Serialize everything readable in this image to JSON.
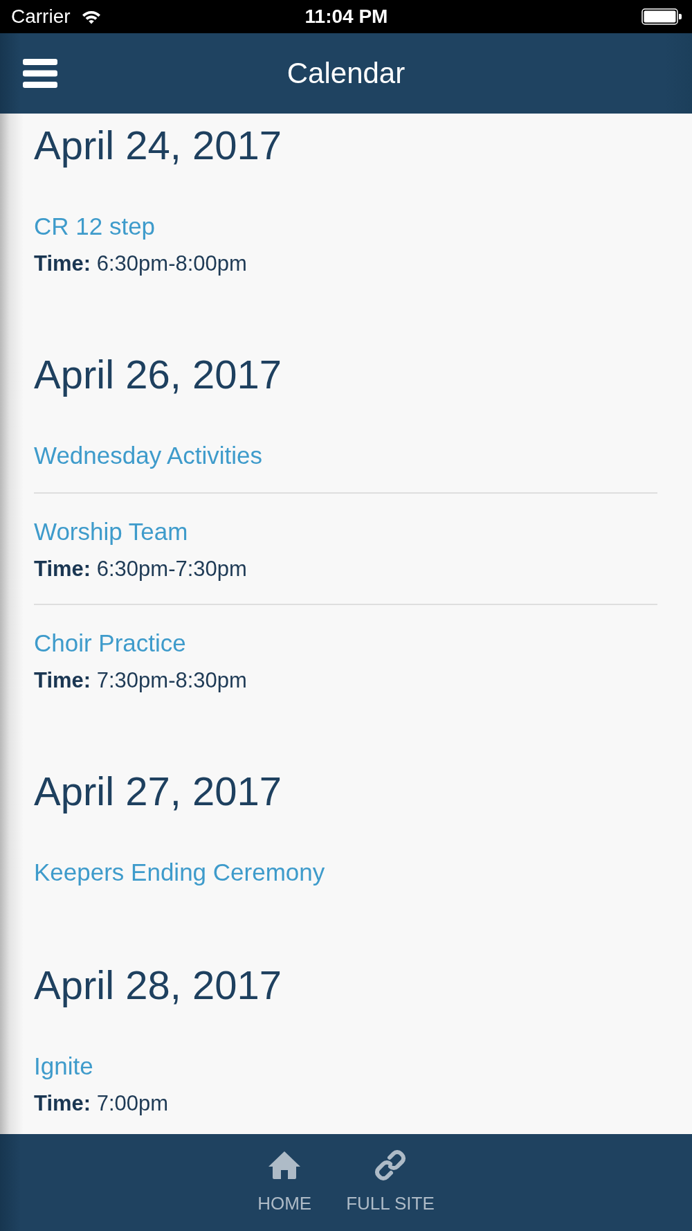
{
  "status_bar": {
    "carrier": "Carrier",
    "time": "11:04 PM"
  },
  "nav_bar": {
    "title": "Calendar"
  },
  "days": [
    {
      "date": "April 24, 2017",
      "events": [
        {
          "title": "CR 12 step",
          "time": "**Time:** 6:30pm-8:00pm"
        }
      ]
    },
    {
      "date": "April 26, 2017",
      "events": [
        {
          "title": "Wednesday Activities"
        },
        {
          "title": "Worship Team",
          "time": "**Time:** 6:30pm-7:30pm"
        },
        {
          "title": "Choir Practice",
          "time": "**Time:** 7:30pm-8:30pm"
        }
      ]
    },
    {
      "date": "April 27, 2017",
      "events": [
        {
          "title": "Keepers Ending Ceremony"
        }
      ]
    },
    {
      "date": "April 28, 2017",
      "events": [
        {
          "title": "Ignite",
          "time": "**Time:** 7:00pm"
        }
      ]
    }
  ],
  "bottom_bar": {
    "items": [
      {
        "kind": "home",
        "label": "HOME"
      },
      {
        "kind": "link",
        "label": "FULL SITE"
      }
    ]
  }
}
